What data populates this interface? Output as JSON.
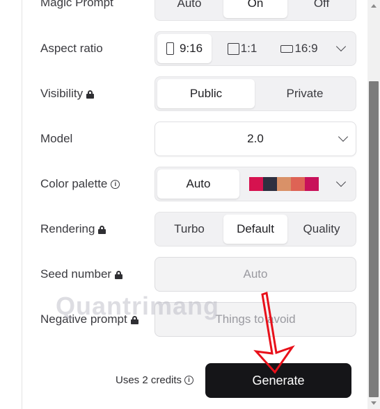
{
  "magic_prompt": {
    "label": "Magic Prompt",
    "options": [
      "Auto",
      "On",
      "Off"
    ],
    "selected": "On"
  },
  "aspect_ratio": {
    "label": "Aspect ratio",
    "options": [
      {
        "label": "9:16",
        "icon": "portrait-icon"
      },
      {
        "label": "1:1",
        "icon": "square-icon"
      },
      {
        "label": "16:9",
        "icon": "landscape-icon"
      }
    ],
    "selected": "9:16"
  },
  "visibility": {
    "label": "Visibility",
    "options": [
      "Public",
      "Private"
    ],
    "selected": "Public"
  },
  "model": {
    "label": "Model",
    "value": "2.0"
  },
  "color_palette": {
    "label": "Color palette",
    "value": "Auto",
    "swatches": [
      "#d6124f",
      "#2f3040",
      "#d99168",
      "#de6355",
      "#c8115a"
    ]
  },
  "rendering": {
    "label": "Rendering",
    "options": [
      "Turbo",
      "Default",
      "Quality"
    ],
    "selected": "Default"
  },
  "seed_number": {
    "label": "Seed number",
    "placeholder": "Auto"
  },
  "negative_prompt": {
    "label": "Negative prompt",
    "placeholder": "Things to avoid"
  },
  "footer": {
    "credits_text": "Uses 2 credits",
    "generate_label": "Generate"
  },
  "watermark": "Quantrimang",
  "colors": {
    "annotation_arrow": "#e8101a",
    "button_bg": "#151518"
  }
}
